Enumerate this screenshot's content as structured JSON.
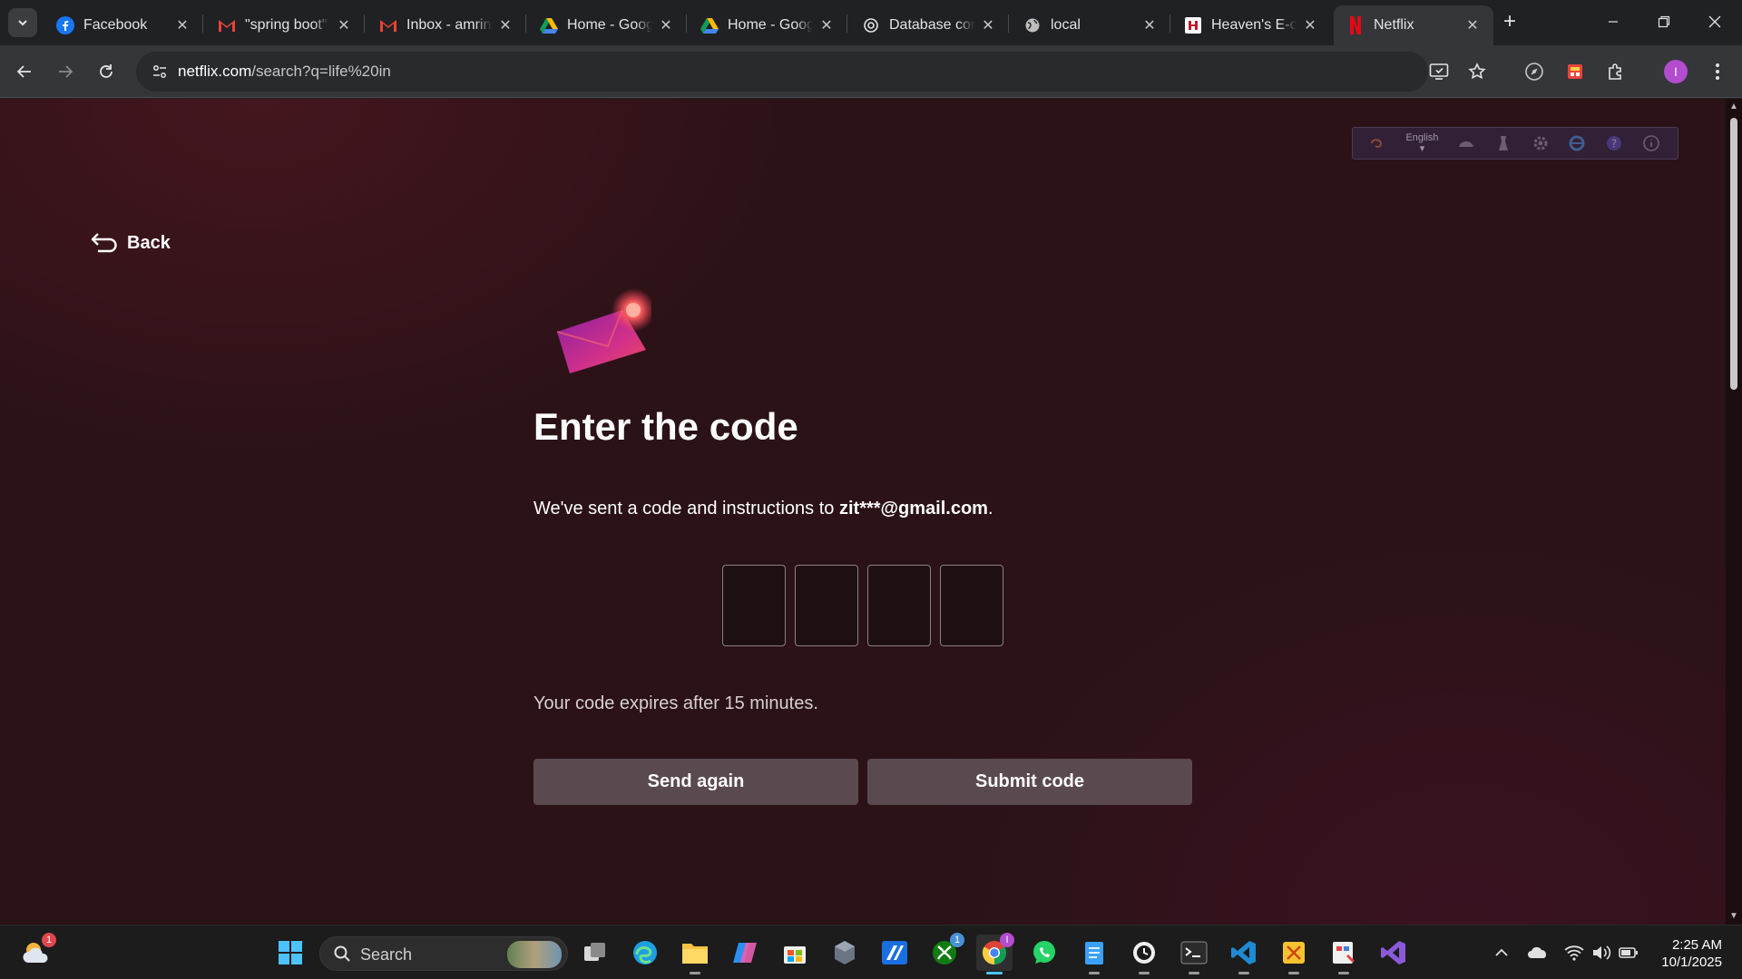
{
  "browser": {
    "tabs": [
      {
        "title": "Facebook",
        "icon": "facebook-icon",
        "active": false
      },
      {
        "title": "\"spring boot\"",
        "icon": "gmail-icon",
        "active": false
      },
      {
        "title": "Inbox - amrin",
        "icon": "gmail-icon",
        "active": false
      },
      {
        "title": "Home - Goog",
        "icon": "google-drive-icon",
        "active": false
      },
      {
        "title": "Home - Goog",
        "icon": "google-drive-icon",
        "active": false
      },
      {
        "title": "Database con",
        "icon": "chatgpt-icon",
        "active": false
      },
      {
        "title": "local",
        "icon": "globe-icon",
        "active": false
      },
      {
        "title": "Heaven's E-c",
        "icon": "heavens-icon",
        "active": false
      },
      {
        "title": "Netflix",
        "icon": "netflix-icon",
        "active": true
      }
    ],
    "url": {
      "host": "netflix.com",
      "path": "/search?q=life%20in"
    },
    "profile_initial": "I",
    "accent": "#b34ccf"
  },
  "extension_toolbar": {
    "language": "English"
  },
  "page": {
    "back_label": "Back",
    "title": "Enter the code",
    "description_prefix": "We've sent a code and instructions to ",
    "email": "zit***@gmail.com",
    "description_suffix": ".",
    "code_fields": [
      "",
      "",
      "",
      ""
    ],
    "expires_text": "Your code expires after 15 minutes.",
    "send_again_label": "Send again",
    "submit_label": "Submit code"
  },
  "taskbar": {
    "weather_badge": "1",
    "search_label": "Search",
    "xbox_badge": "1",
    "time": "2:25 AM",
    "date": "10/1/2025"
  },
  "colors": {
    "page_background": "#2a1217",
    "button_background": "#5a4a50",
    "netflix_red": "#e50914"
  }
}
